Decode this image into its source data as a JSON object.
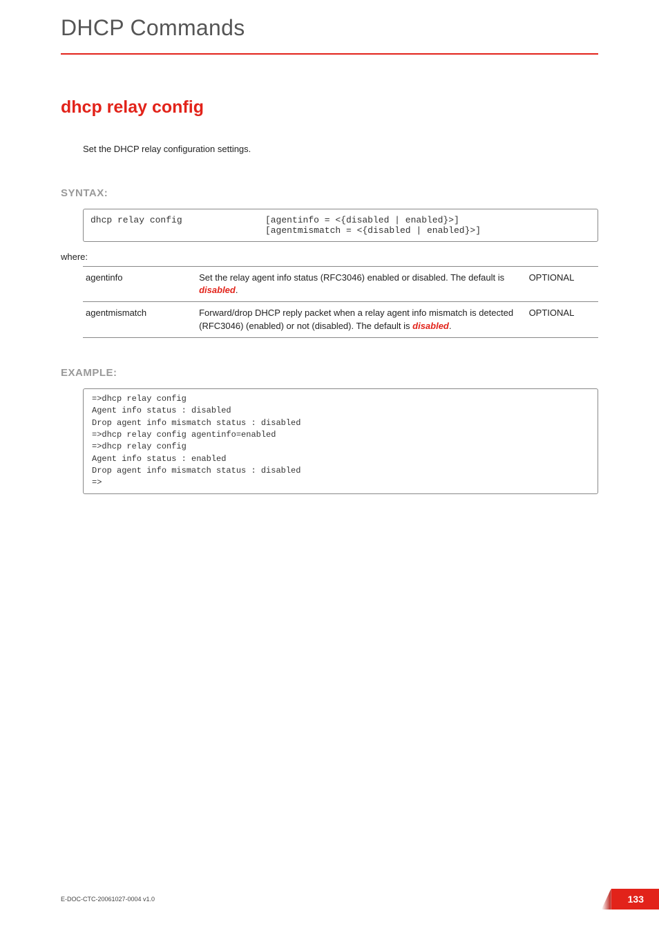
{
  "header": {
    "chapter_title": "DHCP Commands"
  },
  "command": {
    "title": "dhcp relay config",
    "description": "Set the DHCP relay configuration settings."
  },
  "syntax": {
    "label": "SYNTAX:",
    "cmd": "dhcp relay config",
    "args": "[agentinfo = <{disabled | enabled}>]\n[agentmismatch = <{disabled | enabled}>]"
  },
  "where": {
    "label": "where:",
    "rows": [
      {
        "name": "agentinfo",
        "desc_pre": "Set the relay agent info status (RFC3046) enabled or disabled. The default is ",
        "default": "disabled",
        "desc_post": ".",
        "flag": "OPTIONAL"
      },
      {
        "name": "agentmismatch",
        "desc_pre": "Forward/drop DHCP reply packet when a relay agent info mismatch is detected (RFC3046) (enabled) or not (disabled). The default is ",
        "default": "disabled",
        "desc_post": ".",
        "flag": "OPTIONAL"
      }
    ]
  },
  "example": {
    "label": "EXAMPLE:",
    "body": "=>dhcp relay config\nAgent info status : disabled\nDrop agent info mismatch status : disabled\n=>dhcp relay config agentinfo=enabled\n=>dhcp relay config\nAgent info status : enabled\nDrop agent info mismatch status : disabled\n=>"
  },
  "footer": {
    "doc_id": "E-DOC-CTC-20061027-0004 v1.0",
    "page": "133"
  }
}
